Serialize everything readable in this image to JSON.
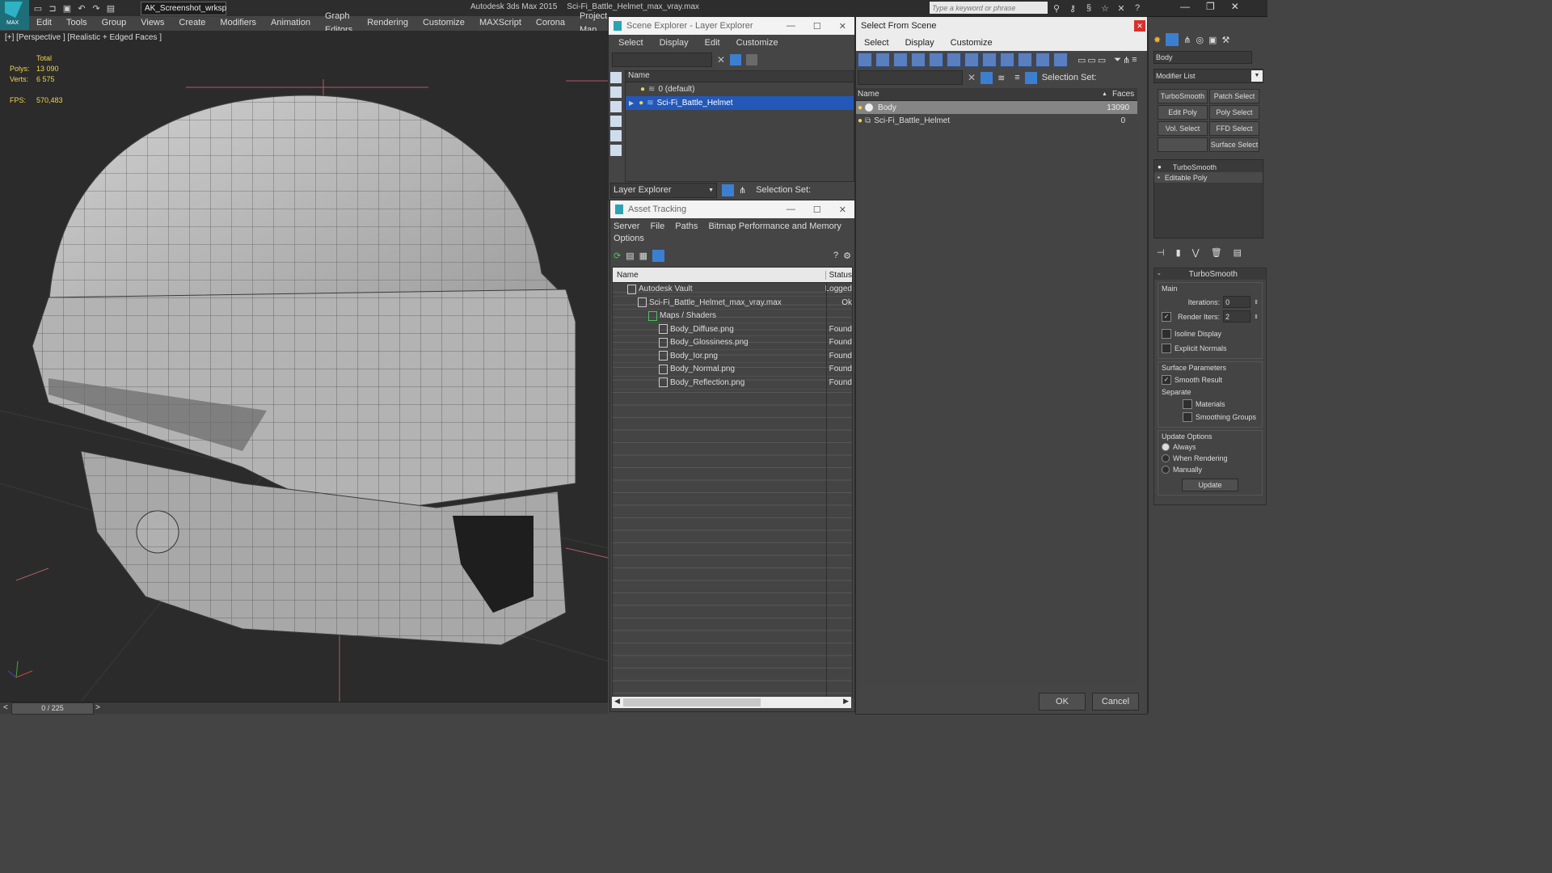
{
  "app": {
    "title": "Autodesk 3ds Max  2015",
    "filename": "Sci-Fi_Battle_Helmet_max_vray.max",
    "workspace": "AK_Screenshot_wrksp",
    "search_placeholder": "Type a keyword or phrase",
    "logo_text": "MAX"
  },
  "menu": [
    "Edit",
    "Tools",
    "Group",
    "Views",
    "Create",
    "Modifiers",
    "Animation",
    "Graph Editors",
    "Rendering",
    "Customize",
    "MAXScript",
    "Corona",
    "Project Man"
  ],
  "viewport": {
    "label": "[+] [Perspective ] [Realistic + Edged Faces ]",
    "stats": {
      "total_label": "Total",
      "polys_label": "Polys:",
      "polys": "13 090",
      "verts_label": "Verts:",
      "verts": "6 575",
      "fps_label": "FPS:",
      "fps": "570,483"
    }
  },
  "timeline": {
    "frame": "0 / 225",
    "prev": "<",
    "next": ">"
  },
  "scene_explorer": {
    "title": "Scene Explorer - Layer Explorer",
    "menu": [
      "Select",
      "Display",
      "Edit",
      "Customize"
    ],
    "col_name": "Name",
    "layers": [
      "0 (default)",
      "Sci-Fi_Battle_Helmet"
    ],
    "footer_dropdown": "Layer Explorer",
    "selection_set_label": "Selection Set:"
  },
  "asset_tracking": {
    "title": "Asset Tracking",
    "menu": [
      "Server",
      "File",
      "Paths",
      "Bitmap Performance and Memory"
    ],
    "menu2": "Options",
    "col_name": "Name",
    "col_status": "Status",
    "rows": [
      {
        "name": "Autodesk Vault",
        "status": "Logged",
        "indent": 0
      },
      {
        "name": "Sci-Fi_Battle_Helmet_max_vray.max",
        "status": "Ok",
        "indent": 1
      },
      {
        "name": "Maps / Shaders",
        "status": "",
        "indent": 2
      },
      {
        "name": "Body_Diffuse.png",
        "status": "Found",
        "indent": 3
      },
      {
        "name": "Body_Glossiness.png",
        "status": "Found",
        "indent": 3
      },
      {
        "name": "Body_Ior.png",
        "status": "Found",
        "indent": 3
      },
      {
        "name": "Body_Normal.png",
        "status": "Found",
        "indent": 3
      },
      {
        "name": "Body_Reflection.png",
        "status": "Found",
        "indent": 3
      }
    ]
  },
  "select_from_scene": {
    "title": "Select From Scene",
    "menu": [
      "Select",
      "Display",
      "Customize"
    ],
    "selection_set_label": "Selection Set:",
    "col_name": "Name",
    "col_faces": "Faces",
    "rows": [
      {
        "name": "Body",
        "faces": "13090",
        "selected": true
      },
      {
        "name": "Sci-Fi_Battle_Helmet",
        "faces": "0",
        "selected": false
      }
    ],
    "ok": "OK",
    "cancel": "Cancel"
  },
  "command_panel": {
    "object_name": "Body",
    "modifier_list": "Modifier List",
    "buttons": [
      "TurboSmooth",
      "Patch Select",
      "Edit Poly",
      "Poly Select",
      "Vol. Select",
      "FFD Select",
      "Surface Select"
    ],
    "stack": [
      "TurboSmooth",
      "Editable Poly"
    ],
    "rollout_title": "TurboSmooth",
    "main_label": "Main",
    "iterations_label": "Iterations:",
    "iterations": "0",
    "render_iters_label": "Render Iters:",
    "render_iters": "2",
    "isoline_label": "Isoline Display",
    "explicit_normals_label": "Explicit Normals",
    "surface_params_label": "Surface Parameters",
    "smooth_result_label": "Smooth Result",
    "separate_label": "Separate",
    "materials_label": "Materials",
    "smoothing_groups_label": "Smoothing Groups",
    "update_options_label": "Update Options",
    "always_label": "Always",
    "when_rendering_label": "When Rendering",
    "manually_label": "Manually",
    "update_button": "Update"
  },
  "colors": {
    "accent": "#1f5fbf",
    "panel": "#454545",
    "viewport": "#2b2b2b"
  }
}
